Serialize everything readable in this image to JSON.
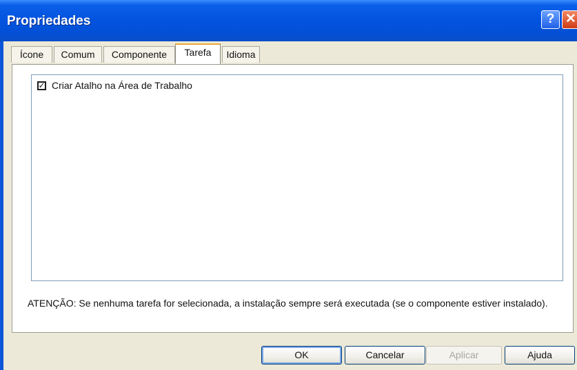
{
  "window": {
    "title": "Propriedades",
    "help_label": "?",
    "close_label": "✕"
  },
  "tabs": [
    {
      "label": "Ícone"
    },
    {
      "label": "Comum"
    },
    {
      "label": "Componente"
    },
    {
      "label": "Tarefa",
      "active": true
    },
    {
      "label": "Idioma"
    }
  ],
  "task_list": {
    "items": [
      {
        "label": "Criar Atalho na Área de Trabalho",
        "checked": true,
        "check_glyph": "✓"
      }
    ]
  },
  "notice": "ATENÇÃO: Se nenhuma tarefa for selecionada, a instalação sempre será executada (se o componente estiver instalado).",
  "buttons": {
    "ok": "OK",
    "cancel": "Cancelar",
    "apply": "Aplicar",
    "help": "Ajuda"
  },
  "colors": {
    "titlebar": "#0454e0",
    "dialog_bg": "#ece9d8",
    "active_tab_accent": "#e8a63a"
  }
}
